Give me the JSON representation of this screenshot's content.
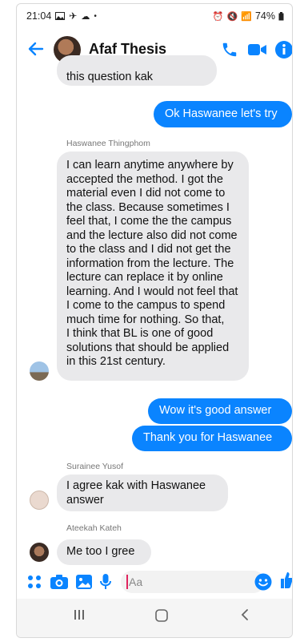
{
  "status": {
    "time": "21:04",
    "battery": "74%"
  },
  "header": {
    "title": "Afaf Thesis"
  },
  "messages": {
    "partial_top": "this question kak",
    "out1": "Ok Haswanee let's try",
    "sender1": "Haswanee Thingphom",
    "in1_lines": [
      "I can learn anytime anywhere by",
      "accepted the method. I got the",
      "material even I did not come to",
      "the class. Because sometimes I",
      "feel that, I come the the campus",
      "and the lecture also did not come",
      "to the class and I did not get the",
      "information from the lecture. The",
      "lecture can replace it by online",
      "learning. And I would not feel that",
      "I come to the campus to spend",
      "much time for nothing.  So that,",
      "I think that BL is one of good",
      "solutions that should be applied",
      "in this 21st century."
    ],
    "out2": "Wow it's good answer",
    "out3": "Thank you for Haswanee",
    "sender2": "Surainee Yusof",
    "in2_lines": [
      "I agree kak with Haswanee",
      "answer"
    ],
    "sender3": "Ateekah Kateh",
    "in3": "Me too I gree"
  },
  "composer": {
    "placeholder": "Aa"
  },
  "icons": [
    "back-arrow-icon",
    "phone-icon",
    "video-icon",
    "info-icon",
    "apps-icon",
    "camera-icon",
    "gallery-icon",
    "mic-icon",
    "emoji-icon",
    "like-icon"
  ],
  "colors": {
    "accent": "#0a84ff",
    "incoming_bubble": "#e9e9eb",
    "online": "#44c552"
  }
}
